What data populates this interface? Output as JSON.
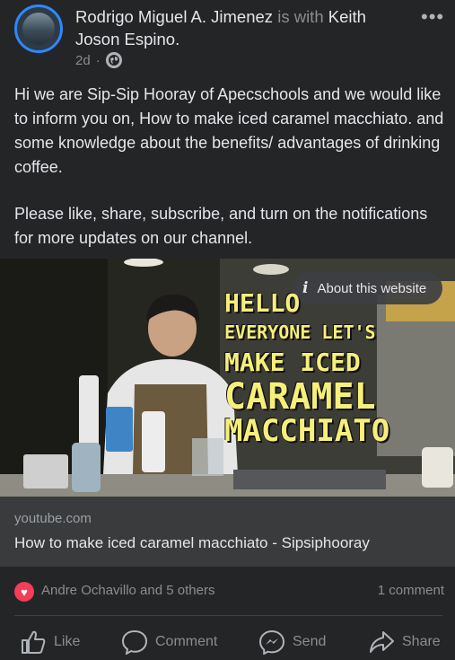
{
  "post": {
    "author": "Rodrigo Miguel A. Jimenez",
    "with_word": "is with",
    "tagged": "Keith Joson Espino.",
    "time": "2d",
    "dot": "·",
    "more_icon": "more-icon",
    "globe_icon": "globe-icon",
    "text_paragraphs": [
      "Hi we are Sip-Sip Hooray of Apecschools and we would like to inform you on, How to make iced caramel macchiato. and some knowledge about the benefits/ advantages of drinking coffee.",
      "Please like, share, subscribe, and turn on the notifications for more updates on our channel."
    ]
  },
  "media": {
    "about_label": "About this website",
    "overlay": [
      "HELLO",
      "EVERYONE LET'S",
      "MAKE ICED",
      "CARAMEL",
      "MACCHIATO"
    ]
  },
  "link": {
    "domain": "youtube.com",
    "title": "How to make iced caramel macchiato - Sipsiphooray"
  },
  "reactions": {
    "text": "Andre Ochavillo and 5 others",
    "comments": "1 comment"
  },
  "actions": {
    "like": "Like",
    "comment": "Comment",
    "send": "Send",
    "share": "Share"
  },
  "colors": {
    "background": "#242526",
    "link_bar": "#3a3b3c",
    "accent": "#2d88ff",
    "love": "#f33e58",
    "overlay_text": "#f6ef7a"
  }
}
